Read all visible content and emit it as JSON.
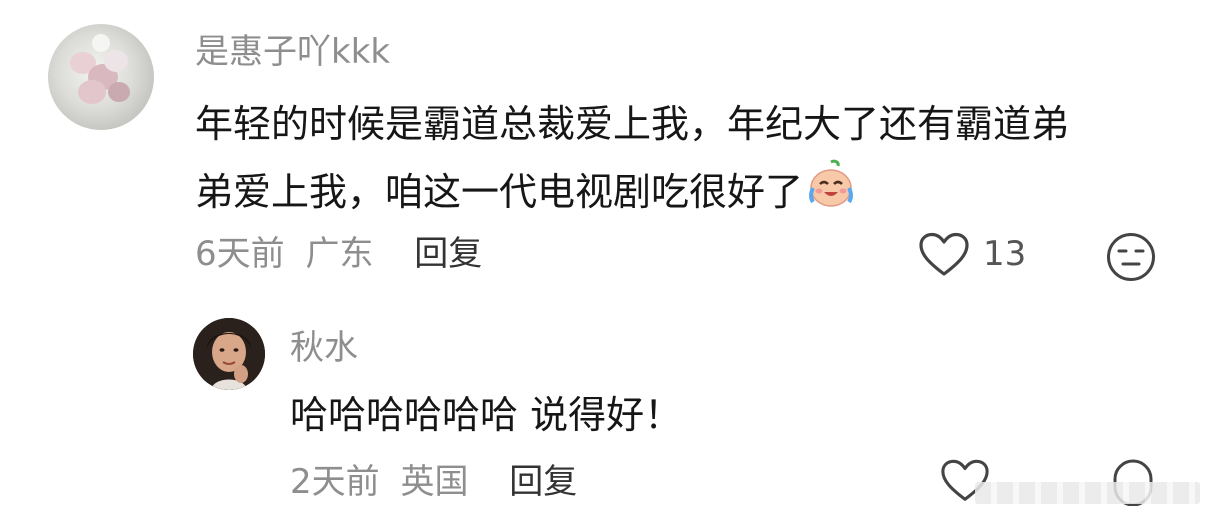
{
  "comment": {
    "username": "是惠子吖kkk",
    "content_line1": "年轻的时候是霸道总裁爱上我，年纪大了还有霸道弟",
    "content_line2": "弟爱上我，咱这一代电视剧吃很好了",
    "emoji": "laughing-crying-face-icon",
    "time": "6天前",
    "location": "广东",
    "reply_label": "回复",
    "like_count": "13"
  },
  "reply": {
    "username": "秋水",
    "content": "哈哈哈哈哈哈 说得好！",
    "time": "2天前",
    "location": "英国",
    "reply_label": "回复"
  },
  "colors": {
    "meta_text": "#8e8e8e",
    "body_text": "#161616",
    "icon_stroke": "#444444",
    "emoji_face": "#f8c9a8",
    "emoji_tears": "#5aa9f0"
  }
}
